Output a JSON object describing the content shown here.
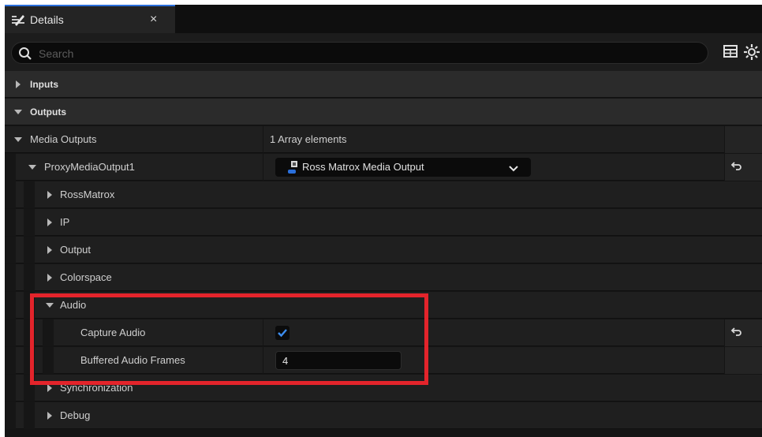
{
  "tab": {
    "title": "Details",
    "close_glyph": "×",
    "icon": "details-pencil-icon"
  },
  "search": {
    "placeholder": "Search",
    "value": ""
  },
  "toolbar": {
    "icons": [
      "table-view-icon",
      "settings-gear-icon"
    ]
  },
  "categories": {
    "inputs": "Inputs",
    "outputs": "Outputs"
  },
  "media_outputs": {
    "label": "Media Outputs",
    "value": "1 Array elements"
  },
  "proxy": {
    "label": "ProxyMediaOutput1",
    "combo_label": "Ross Matrox Media Output",
    "combo_icon": "media-output-icon"
  },
  "groups": {
    "ross_matrox": "RossMatrox",
    "ip": "IP",
    "output": "Output",
    "colorspace": "Colorspace",
    "audio": "Audio",
    "synchronization": "Synchronization",
    "debug": "Debug"
  },
  "audio": {
    "capture_label": "Capture Audio",
    "capture_checked": true,
    "buffered_label": "Buffered Audio Frames",
    "buffered_value": "4"
  },
  "colors": {
    "panel_bg": "#151515",
    "category_bg": "#2b2b2b",
    "row_bg": "#1f1f1f",
    "accent_blue": "#2a6fdb",
    "highlight_red": "#e3242b"
  }
}
